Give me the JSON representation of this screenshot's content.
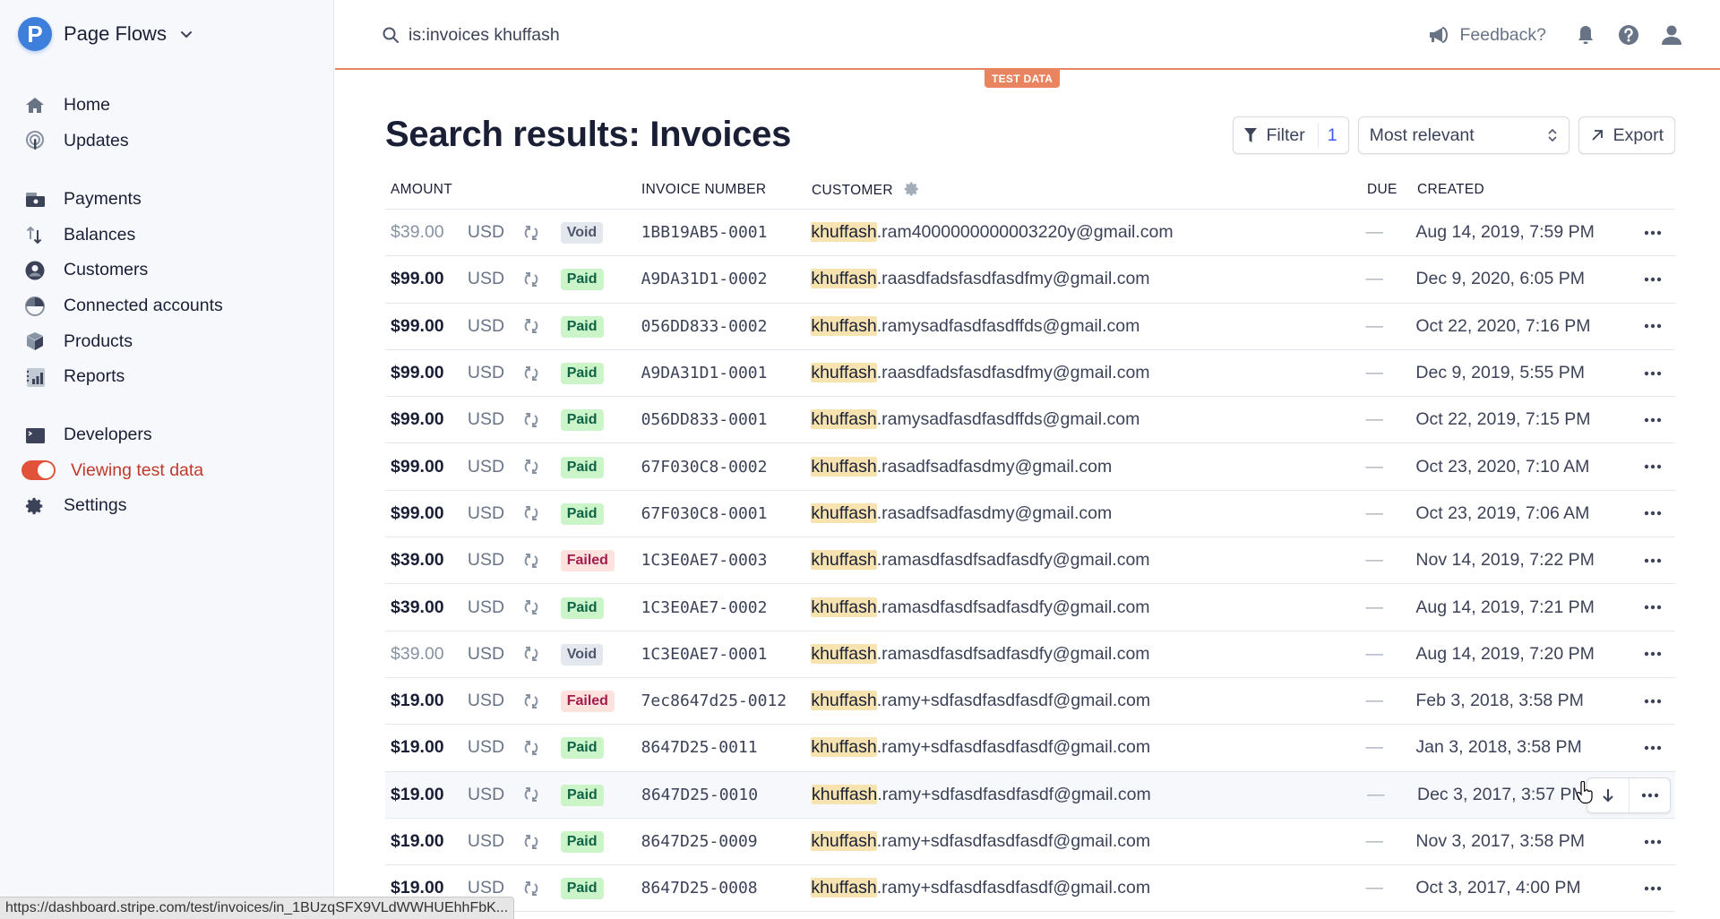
{
  "app": {
    "brand_initial": "P",
    "brand_name": "Page Flows"
  },
  "sidebar": {
    "primary": [
      {
        "label": "Home",
        "icon": "home-icon"
      },
      {
        "label": "Updates",
        "icon": "broadcast-icon"
      }
    ],
    "secondary": [
      {
        "label": "Payments",
        "icon": "wallet-icon"
      },
      {
        "label": "Balances",
        "icon": "transfer-arrows-icon"
      },
      {
        "label": "Customers",
        "icon": "user-circle-icon"
      },
      {
        "label": "Connected accounts",
        "icon": "pie-icon"
      },
      {
        "label": "Products",
        "icon": "box-icon"
      },
      {
        "label": "Reports",
        "icon": "bar-chart-icon"
      }
    ],
    "tertiary": [
      {
        "label": "Developers",
        "icon": "terminal-icon"
      },
      {
        "label": "Viewing test data",
        "icon": "toggle-icon",
        "toggle_on": true
      },
      {
        "label": "Settings",
        "icon": "gear-icon"
      }
    ]
  },
  "header": {
    "search_value": "is:invoices khuffash",
    "feedback_label": "Feedback?",
    "test_badge": "TEST DATA",
    "accent_color": "#e8845f"
  },
  "main": {
    "title": "Search results: Invoices",
    "filter_label": "Filter",
    "filter_count": "1",
    "sort_selected": "Most relevant",
    "export_label": "Export"
  },
  "table": {
    "columns": {
      "amount": "AMOUNT",
      "invoice_number": "INVOICE NUMBER",
      "customer": "CUSTOMER",
      "due": "DUE",
      "created": "CREATED"
    },
    "highlight_term": "khuffash",
    "rows": [
      {
        "amount": "$39.00",
        "currency": "USD",
        "status": "Void",
        "invoice": "1BB19AB5-0001",
        "customer_rest": ".ram4000000000003220y@gmail.com",
        "due": "—",
        "created": "Aug 14, 2019, 7:59 PM"
      },
      {
        "amount": "$99.00",
        "currency": "USD",
        "status": "Paid",
        "invoice": "A9DA31D1-0002",
        "customer_rest": ".raasdfadsfasdfasdfmy@gmail.com",
        "due": "—",
        "created": "Dec 9, 2020, 6:05 PM"
      },
      {
        "amount": "$99.00",
        "currency": "USD",
        "status": "Paid",
        "invoice": "056DD833-0002",
        "customer_rest": ".ramysadfasdfasdffds@gmail.com",
        "due": "—",
        "created": "Oct 22, 2020, 7:16 PM"
      },
      {
        "amount": "$99.00",
        "currency": "USD",
        "status": "Paid",
        "invoice": "A9DA31D1-0001",
        "customer_rest": ".raasdfadsfasdfasdfmy@gmail.com",
        "due": "—",
        "created": "Dec 9, 2019, 5:55 PM"
      },
      {
        "amount": "$99.00",
        "currency": "USD",
        "status": "Paid",
        "invoice": "056DD833-0001",
        "customer_rest": ".ramysadfasdfasdffds@gmail.com",
        "due": "—",
        "created": "Oct 22, 2019, 7:15 PM"
      },
      {
        "amount": "$99.00",
        "currency": "USD",
        "status": "Paid",
        "invoice": "67F030C8-0002",
        "customer_rest": ".rasadfsadfasdmy@gmail.com",
        "due": "—",
        "created": "Oct 23, 2020, 7:10 AM"
      },
      {
        "amount": "$99.00",
        "currency": "USD",
        "status": "Paid",
        "invoice": "67F030C8-0001",
        "customer_rest": ".rasadfsadfasdmy@gmail.com",
        "due": "—",
        "created": "Oct 23, 2019, 7:06 AM"
      },
      {
        "amount": "$39.00",
        "currency": "USD",
        "status": "Failed",
        "invoice": "1C3E0AE7-0003",
        "customer_rest": ".ramasdfasdfsadfasdfy@gmail.com",
        "due": "—",
        "created": "Nov 14, 2019, 7:22 PM"
      },
      {
        "amount": "$39.00",
        "currency": "USD",
        "status": "Paid",
        "invoice": "1C3E0AE7-0002",
        "customer_rest": ".ramasdfasdfsadfasdfy@gmail.com",
        "due": "—",
        "created": "Aug 14, 2019, 7:21 PM"
      },
      {
        "amount": "$39.00",
        "currency": "USD",
        "status": "Void",
        "invoice": "1C3E0AE7-0001",
        "customer_rest": ".ramasdfasdfsadfasdfy@gmail.com",
        "due": "—",
        "created": "Aug 14, 2019, 7:20 PM"
      },
      {
        "amount": "$19.00",
        "currency": "USD",
        "status": "Failed",
        "invoice": "7ec8647d25-0012",
        "customer_rest": ".ramy+sdfasdfasdfasdf@gmail.com",
        "due": "—",
        "created": "Feb 3, 2018, 3:58 PM"
      },
      {
        "amount": "$19.00",
        "currency": "USD",
        "status": "Paid",
        "invoice": "8647D25-0011",
        "customer_rest": ".ramy+sdfasdfasdfasdf@gmail.com",
        "due": "—",
        "created": "Jan 3, 2018, 3:58 PM"
      },
      {
        "amount": "$19.00",
        "currency": "USD",
        "status": "Paid",
        "invoice": "8647D25-0010",
        "customer_rest": ".ramy+sdfasdfasdfasdf@gmail.com",
        "due": "—",
        "created": "Dec 3, 2017, 3:57 PM",
        "hovered": true
      },
      {
        "amount": "$19.00",
        "currency": "USD",
        "status": "Paid",
        "invoice": "8647D25-0009",
        "customer_rest": ".ramy+sdfasdfasdfasdf@gmail.com",
        "due": "—",
        "created": "Nov 3, 2017, 3:58 PM"
      },
      {
        "amount": "$19.00",
        "currency": "USD",
        "status": "Paid",
        "invoice": "8647D25-0008",
        "customer_rest": ".ramy+sdfasdfasdfasdf@gmail.com",
        "due": "—",
        "created": "Oct 3, 2017, 4:00 PM"
      }
    ]
  },
  "status_bar": {
    "url": "https://dashboard.stripe.com/test/invoices/in_1BUzqSFX9VLdWWHUEhhFbK..."
  }
}
